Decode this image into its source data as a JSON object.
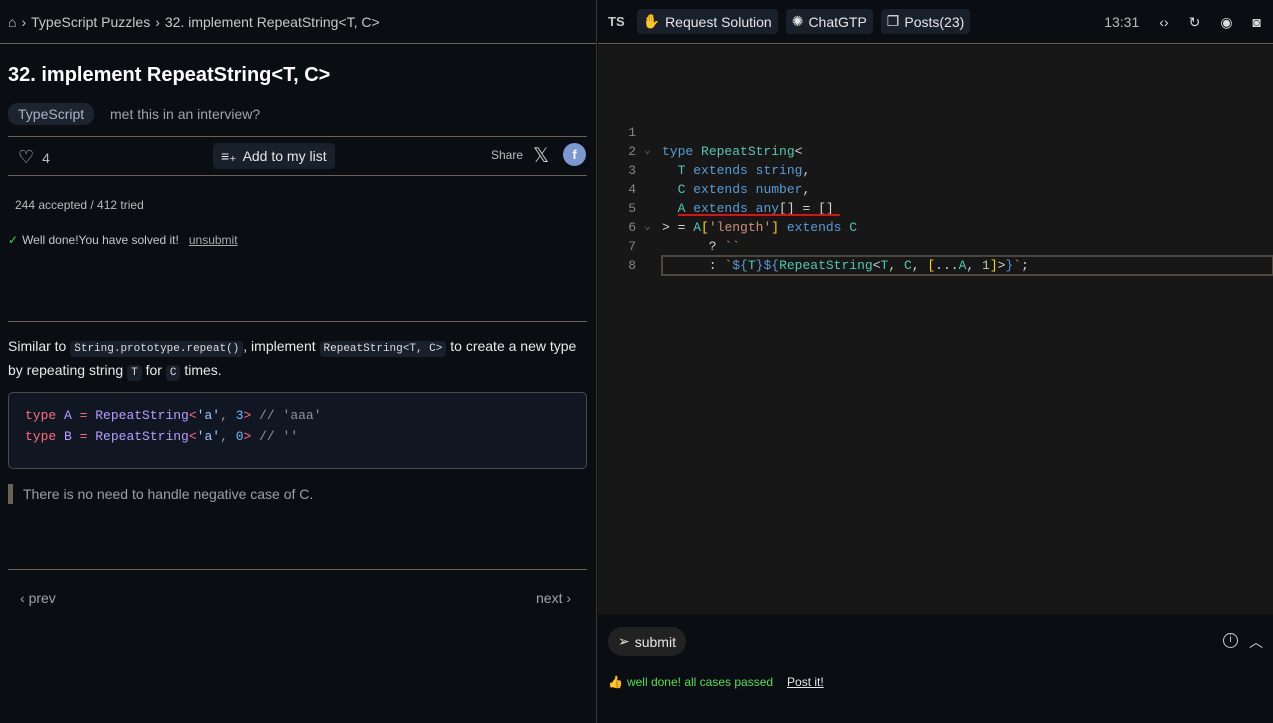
{
  "breadcrumb": {
    "items": [
      "TypeScript Puzzles",
      "32. implement RepeatString<T, C>"
    ]
  },
  "problem": {
    "title": "32. implement RepeatString<T, C>",
    "tag": "TypeScript",
    "met_interview": "met this in an interview?",
    "likes": "4",
    "add_list": "Add to my list",
    "share": "Share",
    "stats": "244 accepted / 412 tried",
    "solved": "Well done!You have solved it!",
    "unsubmit": "unsubmit",
    "desc": {
      "p1": "Similar to",
      "c1": "String.prototype.repeat()",
      "p2": ", implement",
      "c2": "RepeatString<T, C>",
      "p3": "to create a new type by repeating string",
      "c3": "T",
      "p4": "for",
      "c4": "C",
      "p5": "times."
    },
    "example": [
      [
        [
          "type ",
          "kw"
        ],
        [
          "A ",
          "tn"
        ],
        [
          "= ",
          "op"
        ],
        [
          "RepeatString",
          "fn"
        ],
        [
          "<",
          "op"
        ],
        [
          "'a'",
          "str"
        ],
        [
          ", ",
          "cm"
        ],
        [
          "3",
          "num"
        ],
        [
          "> ",
          "op"
        ],
        [
          "// 'aaa'",
          "cm"
        ]
      ],
      [
        [
          "type ",
          "kw"
        ],
        [
          "B ",
          "tn"
        ],
        [
          "= ",
          "op"
        ],
        [
          "RepeatString",
          "fn"
        ],
        [
          "<",
          "op"
        ],
        [
          "'a'",
          "str"
        ],
        [
          ", ",
          "cm"
        ],
        [
          "0",
          "num"
        ],
        [
          "> ",
          "op"
        ],
        [
          "// ''",
          "cm"
        ]
      ]
    ],
    "note": "There is no need to handle negative case of C.",
    "prev": "prev",
    "next": "next"
  },
  "toolbar": {
    "lang": "TS",
    "request": "Request Solution",
    "chatgtp": "ChatGTP",
    "posts": "Posts(23)",
    "time": "13:31"
  },
  "editor": {
    "lines": [
      [],
      [
        [
          "type ",
          "k"
        ],
        [
          "RepeatString",
          "t"
        ],
        [
          "<",
          "p"
        ]
      ],
      [
        [
          "  ",
          " "
        ],
        [
          "T ",
          "t"
        ],
        [
          "extends ",
          "k"
        ],
        [
          "string",
          "k"
        ],
        [
          ",",
          "p"
        ]
      ],
      [
        [
          "  ",
          " "
        ],
        [
          "C ",
          "t"
        ],
        [
          "extends ",
          "k"
        ],
        [
          "number",
          "k"
        ],
        [
          ",",
          "p"
        ]
      ],
      [
        [
          "  ",
          " "
        ],
        [
          "A ",
          "t"
        ],
        [
          "extends ",
          "k"
        ],
        [
          "any",
          "k"
        ],
        [
          "[]",
          "p"
        ],
        [
          " = ",
          "p"
        ],
        [
          "[]",
          "p"
        ]
      ],
      [
        [
          "> = ",
          "p"
        ],
        [
          "A",
          "t"
        ],
        [
          "[",
          "b"
        ],
        [
          "'length'",
          "s"
        ],
        [
          "]",
          "b"
        ],
        [
          " extends ",
          "k"
        ],
        [
          "C",
          "t"
        ]
      ],
      [
        [
          "      ? ",
          "p"
        ],
        [
          "``",
          "s"
        ]
      ],
      [
        [
          "      : ",
          "p"
        ],
        [
          "`",
          "s"
        ],
        [
          "${",
          "k"
        ],
        [
          "T",
          "t"
        ],
        [
          "}",
          "k"
        ],
        [
          "${",
          "k"
        ],
        [
          "RepeatString",
          "t"
        ],
        [
          "<",
          "p"
        ],
        [
          "T",
          "t"
        ],
        [
          ", ",
          "p"
        ],
        [
          "C",
          "t"
        ],
        [
          ", ",
          "p"
        ],
        [
          "[",
          "b"
        ],
        [
          "...",
          "p"
        ],
        [
          "A",
          "t"
        ],
        [
          ", ",
          "p"
        ],
        [
          "1",
          "n"
        ],
        [
          "]",
          "b"
        ],
        [
          ">",
          "p"
        ],
        [
          "}",
          "k"
        ],
        [
          "`",
          "s"
        ],
        [
          ";",
          "p"
        ]
      ]
    ]
  },
  "bottom": {
    "submit": "submit",
    "passed": "well done! all cases passed",
    "post_it": "Post it!"
  }
}
